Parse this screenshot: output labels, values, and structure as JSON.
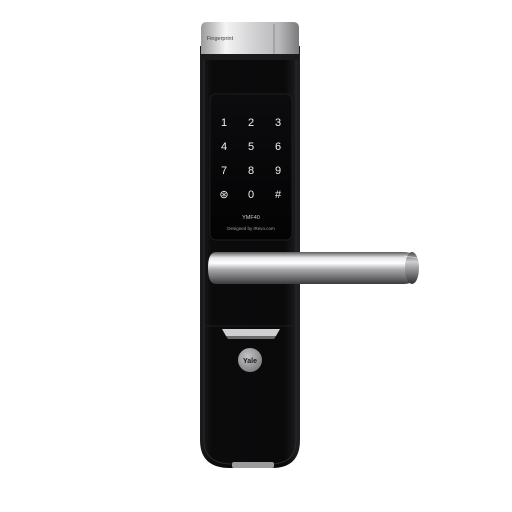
{
  "product": {
    "top_cover_label": "Fingerprint",
    "model_label": "YMF40",
    "designer_label": "Designed by iRevo.com",
    "brand": "Yale"
  },
  "keypad": {
    "keys": [
      "1",
      "2",
      "3",
      "4",
      "5",
      "6",
      "7",
      "8",
      "9",
      "⊛",
      "0",
      "#"
    ]
  },
  "colors": {
    "body": "#0b0b0c",
    "panel": "#050506",
    "key_glyph": "#f2f2f2",
    "chrome_light": "#f4f4f4",
    "chrome_dark": "#6f6f72",
    "logo_badge": "#9a9a9c"
  }
}
